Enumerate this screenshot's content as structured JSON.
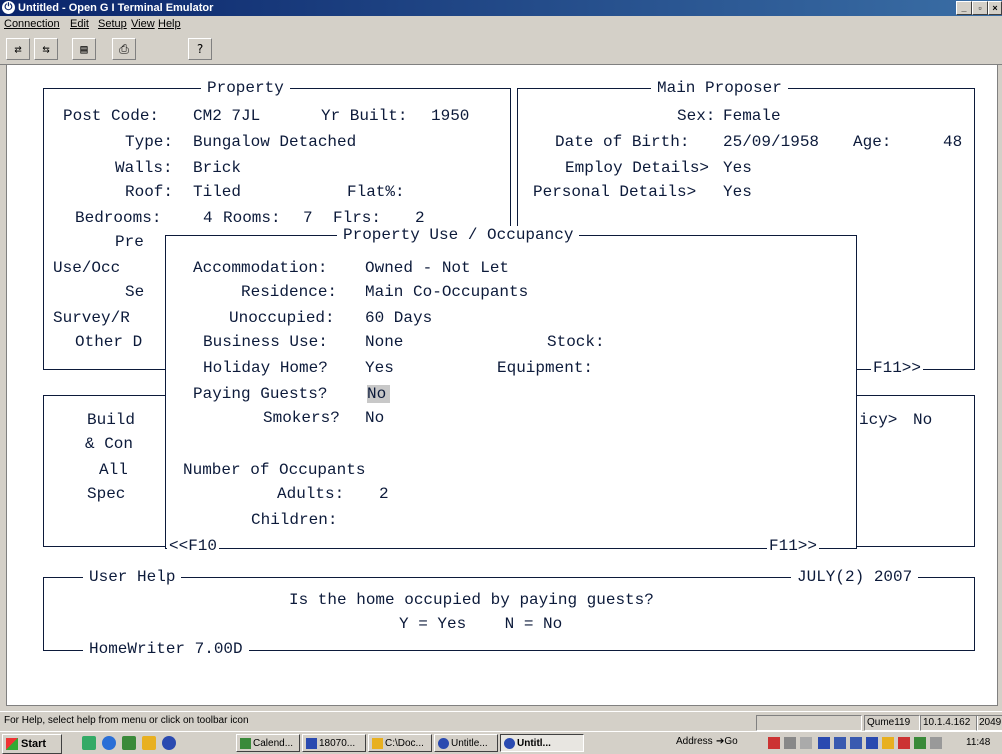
{
  "window": {
    "title": "Untitled - Open G I Terminal Emulator"
  },
  "menu": [
    "Connection",
    "Edit",
    "Setup",
    "View",
    "Help"
  ],
  "toolbar": {
    "b1": "⇄",
    "b2": "⇆",
    "b3": "▤",
    "b4": "⎙",
    "b5": "?"
  },
  "property": {
    "title": "Property",
    "postcode_label": "Post Code:",
    "postcode": "CM2 7JL",
    "yrbuilt_label": "Yr Built:",
    "yrbuilt": "1950",
    "type_label": "Type:",
    "type": "Bungalow Detached",
    "walls_label": "Walls:",
    "walls": "Brick",
    "roof_label": "Roof:",
    "roof": "Tiled",
    "flat_label": "Flat%:",
    "bedrooms_label": "Bedrooms:",
    "bedrooms": "4",
    "rooms_label": "Rooms:",
    "rooms": "7",
    "flrs_label": "Flrs:",
    "flrs": "2",
    "trunc": [
      "Pre",
      "Use/Occ",
      "Se",
      "Survey/R",
      "Other D"
    ]
  },
  "proposer": {
    "title": "Main Proposer",
    "sex_label": "Sex:",
    "sex": "Female",
    "dob_label": "Date of Birth:",
    "dob": "25/09/1958",
    "age_label": "Age:",
    "age": "48",
    "employ_label": "Employ Details>",
    "employ": "Yes",
    "personal_label": "Personal Details>",
    "personal": "Yes",
    "f11": "F11>>"
  },
  "cover": {
    "trunc": [
      "Build",
      "& Con",
      "All",
      "Spec"
    ],
    "policy_label": "icy>",
    "policy": "No"
  },
  "popup": {
    "title": "Property Use / Occupancy",
    "accommodation_label": "Accommodation:",
    "accommodation": "Owned - Not Let",
    "residence_label": "Residence:",
    "residence": "Main Co-Occupants",
    "unoccupied_label": "Unoccupied:",
    "unoccupied": "60 Days",
    "business_label": "Business Use:",
    "business": "None",
    "stock_label": "Stock:",
    "holiday_label": "Holiday Home?",
    "holiday": "Yes",
    "equipment_label": "Equipment:",
    "paying_label": "Paying Guests?",
    "paying": "No",
    "smokers_label": "Smokers?",
    "smokers": "No",
    "occupants_heading": "Number of Occupants",
    "adults_label": "Adults:",
    "adults": "2",
    "children_label": "Children:",
    "f10": "<<F10",
    "f11": "F11>>"
  },
  "help": {
    "title": "User Help",
    "date": "JULY(2) 2007",
    "question": "Is the home occupied by paying guests?",
    "options": "Y = Yes    N = No",
    "version": "HomeWriter 7.00D"
  },
  "status": {
    "hint": "For Help, select help from menu or click on toolbar icon",
    "host": "Qume119",
    "ip": "10.1.4.162",
    "port": "2049"
  },
  "taskbar": {
    "start": "Start",
    "tasks": [
      "Calend...",
      "18070...",
      "C:\\Doc...",
      "Untitle...",
      "Untitl..."
    ],
    "address": "Address",
    "go": "Go",
    "time": "11:48"
  }
}
